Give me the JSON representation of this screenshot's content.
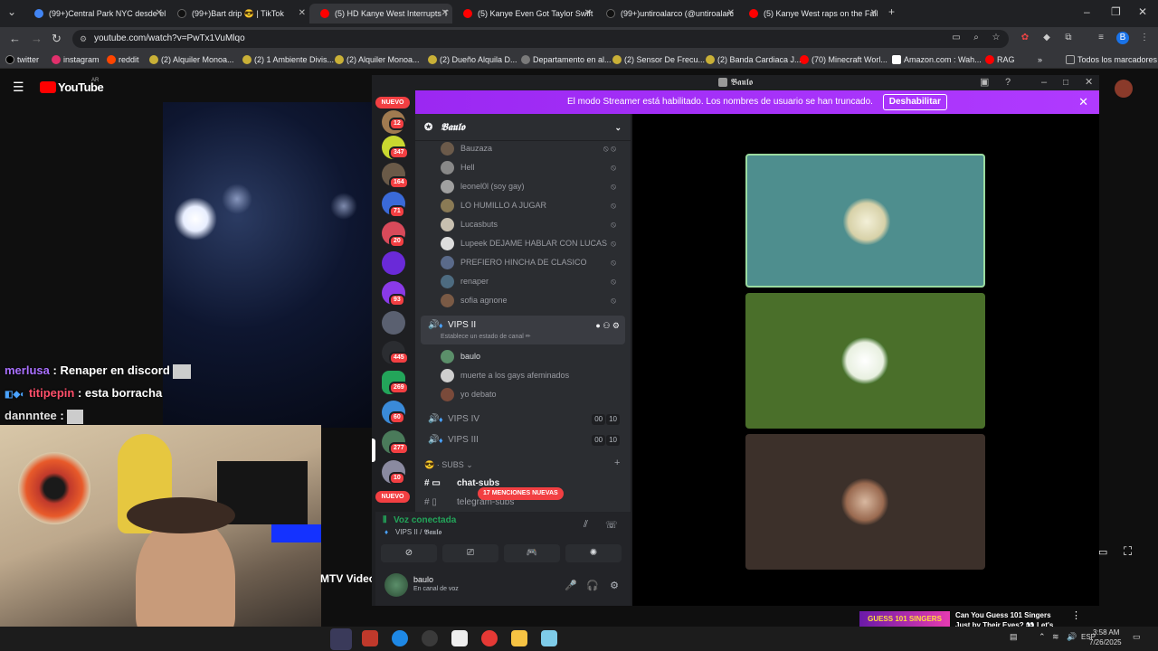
{
  "browser": {
    "tabs": [
      {
        "label": "(99+)Central Park NYC desde el",
        "color": "#4285f4"
      },
      {
        "label": "(99+)Bart drip 😎 | TikTok",
        "color": "#000000"
      },
      {
        "label": "(5) HD Kanye West Interrupts T",
        "color": "#ff0000"
      },
      {
        "label": "(5) Kanye Even Got Taylor Swift",
        "color": "#ff0000"
      },
      {
        "label": "(99+)untiroalarco (@untiroalarc",
        "color": "#000000"
      },
      {
        "label": "(5) Kanye West raps on the Fall",
        "color": "#ff0000"
      }
    ],
    "url": "youtube.com/watch?v=PwTx1VuMlqo",
    "bookmarks": [
      "twitter",
      "instagram",
      "reddit",
      "(2) Alquiler Monoa...",
      "(2) 1 Ambiente Divis...",
      "(2) Alquiler Monoa...",
      "(2) Dueño Alquila D...",
      "Departamento en al...",
      "(2) Sensor De Frecu...",
      "(2) Banda Cardiaca J...",
      "(70) Minecraft Worl...",
      "Amazon.com : Wah...",
      "RAG"
    ],
    "bookmarks_all": "Todos los marcadores"
  },
  "youtube": {
    "logo": "YouTube",
    "region": "AR",
    "chat": [
      {
        "user": "merlusa",
        "text": ": Renaper en discord",
        "color": "#a970ff"
      },
      {
        "user": "titipepin",
        "text": ": esta borracha",
        "color": "#ff4f6a"
      },
      {
        "user": "dannntee",
        "text": ":",
        "color": "#e0e0e0"
      }
    ],
    "side_label": "MTV Video",
    "next_thumb": "GUESS 101 SINGERS",
    "next_title": "Can You Guess 101 Singers Just by Their Eyes? 👀 Let's"
  },
  "discord": {
    "window_title": "𝕭𝖆𝖚𝖑𝖔",
    "server_name": "𝕭𝖆𝖚𝖑𝖔",
    "banner": {
      "text": "El modo Streamer está habilitado. Los nombres de usuario se han truncado.",
      "button": "Deshabilitar"
    },
    "guild_badges": [
      "NUEVO",
      "12",
      "347",
      "164",
      "71",
      "20",
      "",
      "93",
      "",
      "445",
      "269",
      "60",
      "277",
      "10",
      "NUEVO"
    ],
    "members_top": [
      {
        "name": "Bauzaza",
        "color": "#6b5a4a"
      },
      {
        "name": "Hell",
        "color": "#888888"
      },
      {
        "name": "leonel0l (soy gay)",
        "color": "#a0a0a0"
      },
      {
        "name": "LO HUMILLO A JUGAR",
        "color": "#8a7a55"
      },
      {
        "name": "Lucasbuts",
        "color": "#c8c0b0"
      },
      {
        "name": "Lupeek DEJAME HABLAR CON LUCAS",
        "color": "#dddddd"
      },
      {
        "name": "PREFIERO HINCHA DE CLASICO",
        "color": "#5a6a8a"
      },
      {
        "name": "renaper",
        "color": "#4d6b80"
      },
      {
        "name": "sofia agnone",
        "color": "#7a5a45"
      }
    ],
    "vips2": {
      "name": "VIPS II",
      "status": "Establece un estado de canal ✏"
    },
    "vips2_members": [
      {
        "name": "baulo",
        "color": "#5b8f6a"
      },
      {
        "name": "muerte a los gays afeminados",
        "color": "#cfcfcf"
      },
      {
        "name": "yo debato",
        "color": "#7a4a3a"
      }
    ],
    "vips4": {
      "name": "VIPS IV",
      "count_a": "00",
      "count_b": "10"
    },
    "vips3": {
      "name": "VIPS III",
      "count_a": "00",
      "count_b": "10"
    },
    "category": "SUBS",
    "text_channels": [
      "chat-subs",
      "telegram-subs"
    ],
    "mentions": "17 MENCIONES NUEVAS",
    "voice": {
      "status": "Voz conectada",
      "location": "VIPS II / 𝕭𝖆𝖚𝖑𝖔"
    },
    "user": {
      "name": "baulo",
      "status": "En canal de voz"
    },
    "tiles": [
      {
        "bg": "#4e8e8e",
        "border": "#9bdba0"
      },
      {
        "bg": "#4a6f2a",
        "border": "#4a6f2a"
      },
      {
        "bg": "#3c302a",
        "border": "#3c302a"
      }
    ]
  },
  "taskbar": {
    "time": "3:58 AM",
    "date": "7/26/2025",
    "lang": "ESP"
  }
}
